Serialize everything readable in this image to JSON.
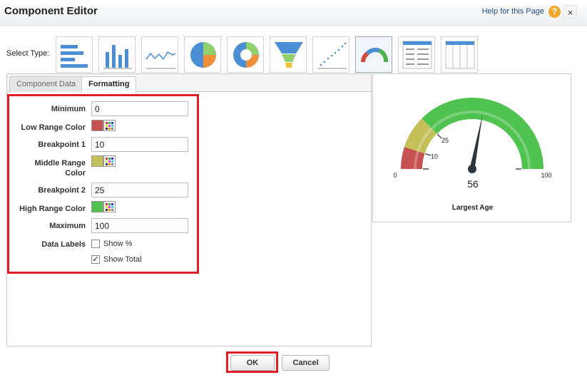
{
  "header": {
    "title": "Component Editor",
    "help_link": "Help for this Page",
    "help_icon": "?",
    "close": "×"
  },
  "select_type": {
    "label": "Select Type:",
    "types": [
      {
        "name": "horizontal-bar-chart"
      },
      {
        "name": "vertical-bar-chart"
      },
      {
        "name": "line-chart"
      },
      {
        "name": "pie-chart"
      },
      {
        "name": "donut-chart"
      },
      {
        "name": "funnel-chart"
      },
      {
        "name": "scatter-chart"
      },
      {
        "name": "gauge-chart",
        "selected": true
      },
      {
        "name": "table"
      },
      {
        "name": "metric-table"
      }
    ]
  },
  "tabs": [
    {
      "label": "Component Data",
      "active": false
    },
    {
      "label": "Formatting",
      "active": true
    }
  ],
  "form": {
    "minimum": {
      "label": "Minimum",
      "value": "0"
    },
    "low_color": {
      "label": "Low Range Color",
      "color": "#c75050"
    },
    "breakpoint1": {
      "label": "Breakpoint 1",
      "value": "10"
    },
    "middle_color": {
      "label_line1": "Middle Range",
      "label_line2": "Color",
      "color": "#c5bf58"
    },
    "breakpoint2": {
      "label": "Breakpoint 2",
      "value": "25"
    },
    "high_color": {
      "label": "High Range Color",
      "color": "#4fc24f"
    },
    "maximum": {
      "label": "Maximum",
      "value": "100"
    },
    "data_labels": {
      "label": "Data Labels",
      "show_percent": {
        "label": "Show %",
        "checked": false
      },
      "show_total": {
        "label": "Show Total",
        "checked": true
      }
    }
  },
  "preview": {
    "value": "56",
    "title": "Largest Age",
    "min_label": "0",
    "max_label": "100",
    "bp1_label": "10",
    "bp2_label": "25"
  },
  "chart_data": {
    "type": "gauge",
    "min": 0,
    "max": 100,
    "value": 56,
    "breakpoints": [
      10,
      25
    ],
    "range_colors": [
      "#c75050",
      "#c5bf58",
      "#4fc24f"
    ],
    "title": "Largest Age"
  },
  "buttons": {
    "ok": "OK",
    "cancel": "Cancel"
  }
}
